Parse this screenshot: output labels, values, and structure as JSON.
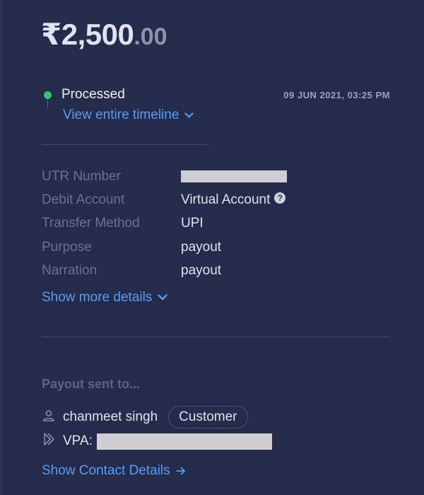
{
  "amount": {
    "main": "₹2,500",
    "decimal": ".00"
  },
  "status": {
    "label": "Processed",
    "timestamp": "09 JUN 2021, 03:25 PM",
    "timeline_link": "View entire timeline"
  },
  "details": {
    "rows": [
      {
        "label": "UTR Number",
        "value": ""
      },
      {
        "label": "Debit Account",
        "value": "Virtual Account"
      },
      {
        "label": "Transfer Method",
        "value": "UPI"
      },
      {
        "label": "Purpose",
        "value": "payout"
      },
      {
        "label": "Narration",
        "value": "payout"
      }
    ],
    "help_glyph": "?",
    "show_more": "Show more details"
  },
  "payout": {
    "heading": "Payout sent to...",
    "recipient_name": "chanmeet singh",
    "recipient_badge": "Customer",
    "vpa_label": "VPA:",
    "contact_link": "Show Contact Details"
  },
  "icons": {
    "status_dot": "status-dot-icon",
    "chevron": "chevron-down-icon",
    "help": "question-circle-icon",
    "user": "user-icon",
    "vpa": "upi-arrow-icon",
    "arrow": "arrow-right-icon"
  },
  "colors": {
    "background": "#252b4a",
    "link": "#559ef7",
    "status_green": "#2ec76c",
    "label": "#6b7190",
    "value": "#dfe3ef"
  }
}
